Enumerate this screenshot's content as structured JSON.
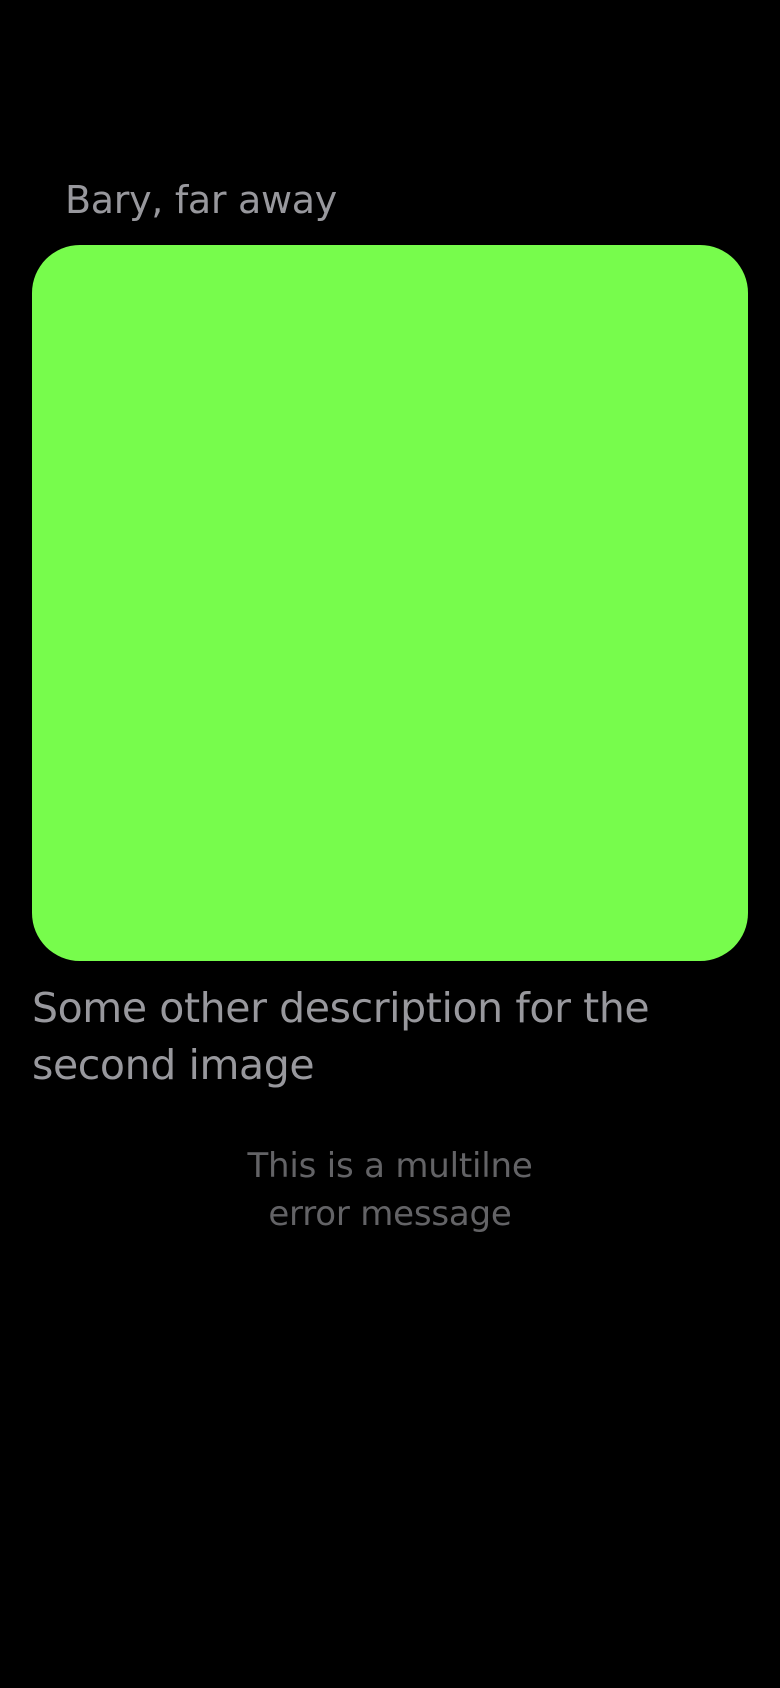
{
  "section": {
    "title": "Bary, far away"
  },
  "image": {
    "color": "#77fc4c"
  },
  "description": {
    "text": "Some other description for the second image"
  },
  "error": {
    "message": "This is a multilne\nerror message"
  },
  "colors": {
    "background": "#000000",
    "secondary_text": "#98989d",
    "tertiary_text": "#636366"
  }
}
